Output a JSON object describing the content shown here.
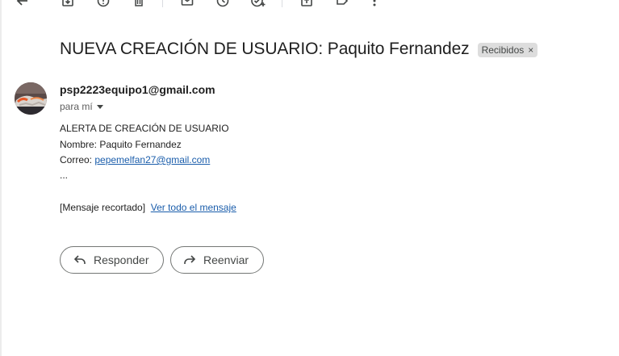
{
  "toolbar": {
    "icons": [
      "back-arrow-icon",
      "archive-icon",
      "report-spam-icon",
      "delete-icon",
      "mark-unread-icon",
      "snooze-icon",
      "add-task-icon",
      "move-to-icon",
      "label-icon",
      "more-vert-icon"
    ]
  },
  "email": {
    "subject": "NUEVA CREACIÓN DE USUARIO: Paquito Fernandez",
    "label": "Recibidos",
    "label_close": "×",
    "sender": "psp2223equipo1@gmail.com",
    "to_me": "para mí",
    "body": {
      "line1": "ALERTA DE CREACIÓN DE USUARIO",
      "line2": "Nombre: Paquito Fernandez",
      "line3_prefix": "Correo: ",
      "line3_link": "pepemelfan27@gmail.com",
      "ellipsis": "...",
      "clipped_text": "[Mensaje recortado]",
      "view_full_link": "Ver todo el mensaje"
    }
  },
  "actions": {
    "reply_label": "Responder",
    "forward_label": "Reenviar"
  },
  "colors": {
    "link": "#1a5dab",
    "chip_bg": "#dddddd",
    "text": "#1f1f1f"
  }
}
